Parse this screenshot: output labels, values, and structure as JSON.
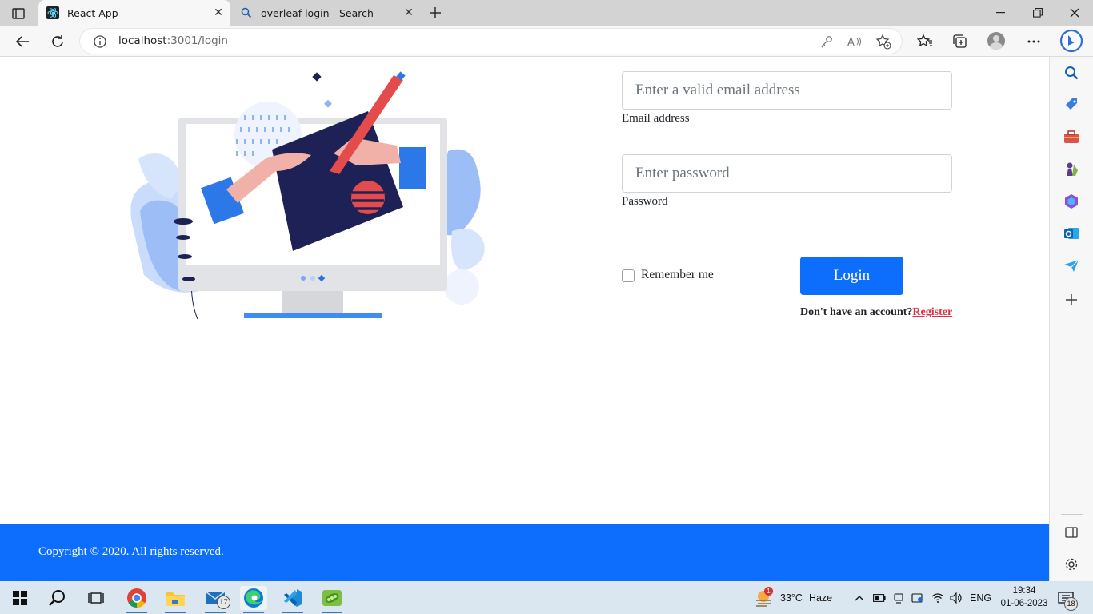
{
  "browser": {
    "tabs": [
      {
        "label": "React App",
        "icon": "react-icon",
        "active": true
      },
      {
        "label": "overleaf login - Search",
        "icon": "search-icon",
        "active": false
      }
    ],
    "url_host": "localhost",
    "url_path": ":3001/login"
  },
  "form": {
    "email_placeholder": "Enter a valid email address",
    "email_label": "Email address",
    "password_placeholder": "Enter password",
    "password_label": "Password",
    "remember_label": "Remember me",
    "login_label": "Login",
    "register_prompt": "Don't have an account?",
    "register_link": "Register"
  },
  "footer": {
    "copyright": "Copyright © 2020. All rights reserved."
  },
  "taskbar": {
    "mail_badge": "17",
    "weather_temp": "33°C",
    "weather_desc": "Haze",
    "weather_badge": "1",
    "language": "ENG",
    "time": "19:34",
    "date": "01-06-2023",
    "notification_count": "18"
  },
  "colors": {
    "primary": "#0d6efd",
    "danger": "#dc3545",
    "illustration_navy": "#1e2156"
  }
}
